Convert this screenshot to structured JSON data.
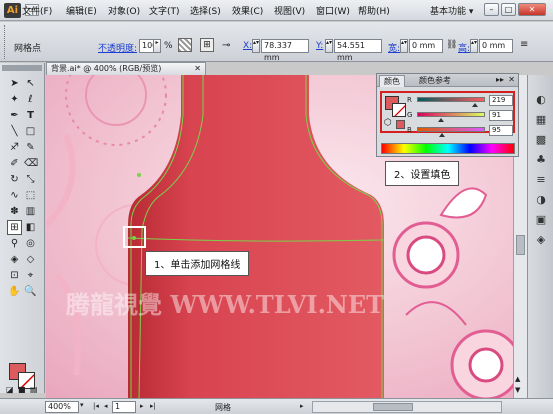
{
  "menubar": {
    "logo": "Ai",
    "items": [
      "文件(F)",
      "编辑(E)",
      "对象(O)",
      "文字(T)",
      "选择(S)",
      "效果(C)",
      "视图(V)",
      "窗口(W)",
      "帮助(H)"
    ],
    "workspace": "基本功能 ▾",
    "window_buttons": [
      "–",
      "□",
      "✕"
    ]
  },
  "controlbar": {
    "object_type": "网格点",
    "opacity_label": "不透明度:",
    "opacity_value": "100",
    "opacity_unit": "%",
    "x_label": "X:",
    "x_value": "78.337 mm",
    "y_label": "Y:",
    "y_value": "54.551 mm",
    "w_label": "宽:",
    "w_value": "0 mm",
    "h_label": "高:",
    "h_value": "0 mm"
  },
  "document": {
    "tab_title": "背景.ai* @ 400% (RGB/预览)",
    "watermark": "腾龍視覺 WWW.TLVI.NET"
  },
  "color_panel": {
    "tabs": [
      "颜色",
      "颜色参考"
    ],
    "fill_color": "#db5b5f",
    "sliders": [
      {
        "label": "R",
        "value": "219",
        "fraction": 0.86
      },
      {
        "label": "G",
        "value": "91",
        "fraction": 0.36
      },
      {
        "label": "B",
        "value": "95",
        "fraction": 0.37
      }
    ]
  },
  "callouts": {
    "step1": "1、单击添加网格线",
    "step2": "2、设置填色"
  },
  "statusbar": {
    "zoom": "400%",
    "page": "1",
    "tool_name": "网格"
  },
  "tools": {
    "fill_color": "#db5b5f"
  }
}
